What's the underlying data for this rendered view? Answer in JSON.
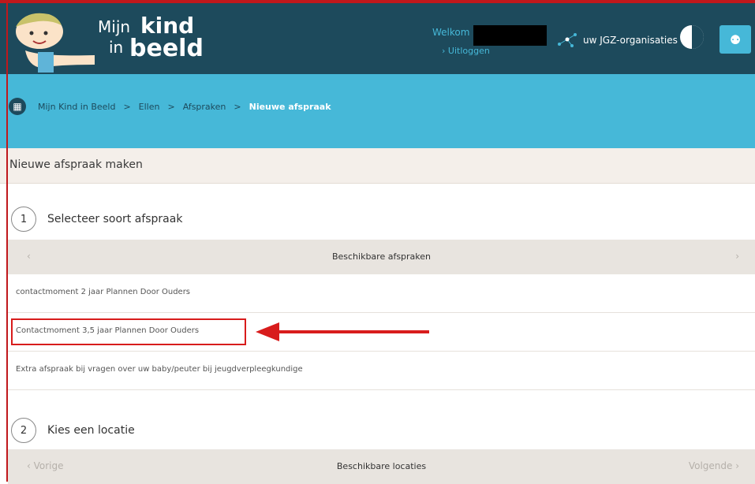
{
  "header": {
    "logo_mijn": "Mijn",
    "logo_kind": "kind",
    "logo_in": "in",
    "logo_beeld": "beeld",
    "welcome_label": "Welkom",
    "logout_label": "Uitloggen",
    "orgs_label": "uw JGZ-organisaties"
  },
  "breadcrumb": {
    "items": [
      "Mijn Kind in Beeld",
      ">",
      "Ellen",
      ">",
      "Afspraken",
      ">"
    ],
    "current": "Nieuwe afspraak"
  },
  "page": {
    "title": "Nieuwe afspraak maken"
  },
  "step1": {
    "number": "1",
    "title": "Selecteer soort afspraak",
    "nav_prev": "‹",
    "nav_label": "Beschikbare afspraken",
    "nav_next": "›",
    "options": [
      "contactmoment 2 jaar Plannen Door Ouders",
      "Contactmoment 3,5 jaar Plannen Door Ouders",
      "Extra afspraak bij vragen over uw baby/peuter bij jeugdverpleegkundige"
    ]
  },
  "step2": {
    "number": "2",
    "title": "Kies een locatie",
    "nav_prev": "‹ Vorige",
    "nav_label": "Beschikbare locaties",
    "nav_next": "Volgende ›"
  },
  "colors": {
    "topbar": "#1d4a5c",
    "accent": "#46b8d8",
    "annotation": "#d81c1c"
  }
}
